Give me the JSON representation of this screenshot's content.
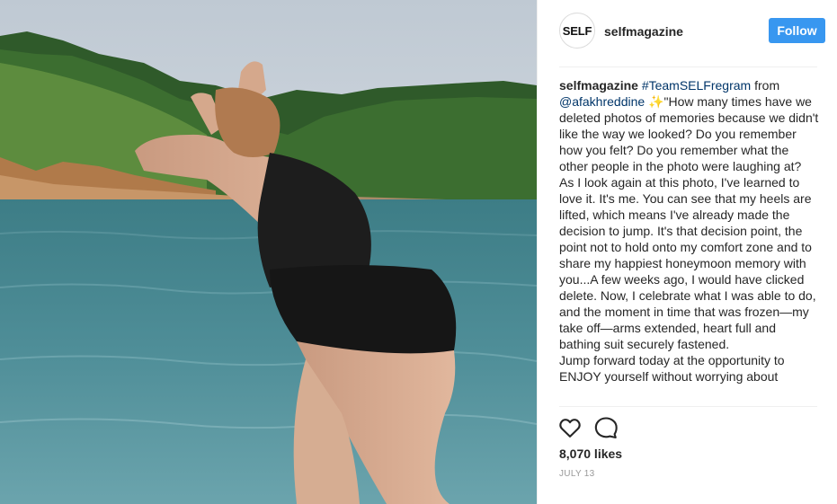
{
  "post": {
    "username": "selfmagazine",
    "avatar_text": "SELF",
    "follow_label": "Follow",
    "caption": {
      "user": "selfmagazine",
      "hashtag": "#TeamSELFregram",
      "from": "from",
      "mention": "@afakhreddine",
      "sparkle": "✨",
      "paragraph1": "\"How many times have we deleted photos of memories because we didn't like the way we looked? Do you remember how you felt? Do you remember what the other people in the photo were laughing at?",
      "paragraph2": "As I look again at this photo, I've learned to love it. It's me. You can see that my heels are lifted, which means I've already made the decision to jump. It's that decision point, the point not to hold onto my comfort zone and to share my happiest honeymoon memory with you...A few weeks ago, I would have clicked delete. Now, I celebrate what I was able to do, and the moment in time that was frozen—my take off—arms extended, heart full and bathing suit securely fastened.",
      "paragraph3": "Jump forward today at the opportunity to ENJOY yourself without worrying about"
    },
    "likes": "8,070 likes",
    "date": "JULY 13",
    "icons": {
      "like": "heart-icon",
      "comment": "comment-icon"
    }
  },
  "colors": {
    "follow_button": "#3897f0",
    "link": "#003569",
    "meta_text": "#999999"
  }
}
